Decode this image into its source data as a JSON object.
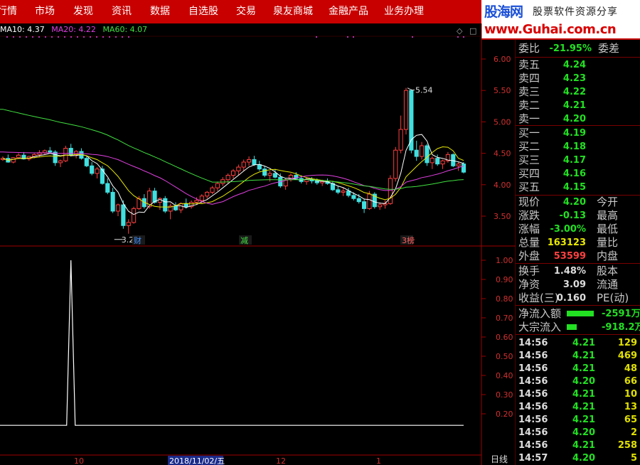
{
  "menu": [
    "行情",
    "市场",
    "发现",
    "资讯",
    "数据",
    "自选股",
    "交易",
    "泉友商城",
    "金融产品",
    "业务办理"
  ],
  "logo": {
    "name": "股海网",
    "slogan": "股票软件资源分享",
    "url": "www.Guhai.com.cn"
  },
  "ma_legend": [
    {
      "label": "MA10: 4.37",
      "color": "#ffffff"
    },
    {
      "label": "MA20: 4.22",
      "color": "#e040e0"
    },
    {
      "label": "MA60: 4.07",
      "color": "#40e040"
    }
  ],
  "price_axis": [
    "6.00",
    "5.50",
    "5.00",
    "4.50",
    "4.00",
    "3.50"
  ],
  "indicator_axis": [
    "1.00",
    "0.90",
    "0.80",
    "0.70",
    "0.60",
    "0.50",
    "0.40",
    "0.30",
    "0.20"
  ],
  "annotations": {
    "high": "5.54",
    "low": "3.22"
  },
  "event_markers": [
    "财",
    "减",
    "3榜"
  ],
  "date_axis": {
    "month1": "10",
    "current_date": "2018/11/02/五",
    "month2": "12",
    "month3": "1",
    "period": "日线"
  },
  "order_book": {
    "wei_bi": {
      "label": "委比",
      "value": "-21.95%",
      "label2": "委差"
    },
    "asks": [
      {
        "label": "卖五",
        "price": "4.24"
      },
      {
        "label": "卖四",
        "price": "4.23"
      },
      {
        "label": "卖三",
        "price": "4.22"
      },
      {
        "label": "卖二",
        "price": "4.21"
      },
      {
        "label": "卖一",
        "price": "4.20"
      }
    ],
    "bids": [
      {
        "label": "买一",
        "price": "4.19"
      },
      {
        "label": "买二",
        "price": "4.18"
      },
      {
        "label": "买三",
        "price": "4.17"
      },
      {
        "label": "买四",
        "price": "4.16"
      },
      {
        "label": "买五",
        "price": "4.15"
      }
    ]
  },
  "quote": {
    "price": {
      "label": "现价",
      "value": "4.20",
      "label2": "今开"
    },
    "change": {
      "label": "涨跌",
      "value": "-0.13",
      "label2": "最高"
    },
    "change_pct": {
      "label": "涨幅",
      "value": "-3.00%",
      "label2": "最低"
    },
    "volume": {
      "label": "总量",
      "value": "163123",
      "label2": "量比"
    },
    "outer": {
      "label": "外盘",
      "value": "53599",
      "label2": "内盘"
    },
    "turnover": {
      "label": "换手",
      "value": "1.48%",
      "label2": "股本"
    },
    "net_asset": {
      "label": "净资",
      "value": "3.09",
      "label2": "流通"
    },
    "eps": {
      "label": "收益(三)",
      "value": "0.160",
      "label2": "PE(动)"
    }
  },
  "flows": [
    {
      "label": "净流入额",
      "value": "-2591万",
      "bar": 0.85
    },
    {
      "label": "大宗流入",
      "value": "-918.2万",
      "bar": 0.3
    }
  ],
  "ticks": [
    {
      "time": "14:56",
      "price": "4.21",
      "vol": "129"
    },
    {
      "time": "14:56",
      "price": "4.21",
      "vol": "469"
    },
    {
      "time": "14:56",
      "price": "4.21",
      "vol": "48"
    },
    {
      "time": "14:56",
      "price": "4.20",
      "vol": "66"
    },
    {
      "time": "14:56",
      "price": "4.21",
      "vol": "10"
    },
    {
      "time": "14:56",
      "price": "4.21",
      "vol": "13"
    },
    {
      "time": "14:56",
      "price": "4.21",
      "vol": "65"
    },
    {
      "time": "14:56",
      "price": "4.20",
      "vol": "2"
    },
    {
      "time": "14:56",
      "price": "4.21",
      "vol": "258"
    },
    {
      "time": "14:57",
      "price": "4.20",
      "vol": "5"
    }
  ],
  "colors": {
    "menu_bg": "#c80000",
    "up": "#ff4040",
    "down": "#40e0e0",
    "green": "#22e022",
    "ma10": "#ffffff",
    "ma20": "#e040e0",
    "ma60": "#40e040"
  },
  "chart_data": {
    "type": "candlestick",
    "price_range": [
      3.2,
      6.1
    ],
    "ohlc": [
      [
        4.4,
        4.45,
        4.38,
        4.42
      ],
      [
        4.42,
        4.48,
        4.35,
        4.36
      ],
      [
        4.36,
        4.44,
        4.34,
        4.43
      ],
      [
        4.43,
        4.5,
        4.41,
        4.47
      ],
      [
        4.47,
        4.52,
        4.4,
        4.41
      ],
      [
        4.41,
        4.46,
        4.38,
        4.45
      ],
      [
        4.45,
        4.5,
        4.42,
        4.48
      ],
      [
        4.48,
        4.55,
        4.44,
        4.51
      ],
      [
        4.51,
        4.56,
        4.48,
        4.54
      ],
      [
        4.54,
        4.6,
        4.5,
        4.52
      ],
      [
        4.52,
        4.55,
        4.3,
        4.35
      ],
      [
        4.35,
        4.4,
        4.28,
        4.38
      ],
      [
        4.38,
        4.62,
        4.36,
        4.58
      ],
      [
        4.58,
        4.65,
        4.45,
        4.48
      ],
      [
        4.48,
        4.55,
        4.42,
        4.53
      ],
      [
        4.53,
        4.58,
        4.4,
        4.42
      ],
      [
        4.42,
        4.46,
        4.28,
        4.3
      ],
      [
        4.3,
        4.36,
        4.15,
        4.18
      ],
      [
        4.18,
        4.28,
        4.1,
        4.25
      ],
      [
        4.25,
        4.3,
        4.0,
        4.02
      ],
      [
        4.02,
        4.1,
        3.85,
        3.88
      ],
      [
        3.88,
        3.95,
        3.55,
        3.58
      ],
      [
        3.58,
        3.7,
        3.5,
        3.68
      ],
      [
        3.68,
        3.75,
        3.3,
        3.35
      ],
      [
        3.35,
        3.45,
        3.22,
        3.4
      ],
      [
        3.4,
        3.65,
        3.38,
        3.62
      ],
      [
        3.62,
        3.82,
        3.6,
        3.78
      ],
      [
        3.78,
        3.85,
        3.62,
        3.65
      ],
      [
        3.65,
        3.95,
        3.62,
        3.9
      ],
      [
        3.9,
        3.95,
        3.7,
        3.72
      ],
      [
        3.72,
        3.8,
        3.6,
        3.78
      ],
      [
        3.78,
        3.82,
        3.55,
        3.58
      ],
      [
        3.58,
        3.7,
        3.45,
        3.66
      ],
      [
        3.66,
        3.72,
        3.58,
        3.6
      ],
      [
        3.6,
        3.72,
        3.55,
        3.7
      ],
      [
        3.7,
        3.78,
        3.62,
        3.65
      ],
      [
        3.65,
        3.75,
        3.62,
        3.72
      ],
      [
        3.72,
        3.8,
        3.68,
        3.75
      ],
      [
        3.75,
        3.85,
        3.7,
        3.82
      ],
      [
        3.82,
        3.9,
        3.78,
        3.88
      ],
      [
        3.88,
        3.98,
        3.85,
        3.95
      ],
      [
        3.95,
        4.05,
        3.9,
        4.02
      ],
      [
        4.02,
        4.12,
        3.98,
        4.08
      ],
      [
        4.08,
        4.18,
        4.02,
        4.15
      ],
      [
        4.15,
        4.25,
        4.1,
        4.22
      ],
      [
        4.22,
        4.32,
        4.15,
        4.28
      ],
      [
        4.28,
        4.4,
        4.22,
        4.36
      ],
      [
        4.36,
        4.45,
        4.3,
        4.4
      ],
      [
        4.4,
        4.46,
        4.3,
        4.32
      ],
      [
        4.32,
        4.38,
        4.22,
        4.25
      ],
      [
        4.25,
        4.3,
        4.12,
        4.15
      ],
      [
        4.15,
        4.22,
        4.05,
        4.18
      ],
      [
        4.18,
        4.25,
        4.1,
        4.12
      ],
      [
        4.12,
        4.18,
        3.95,
        3.98
      ],
      [
        3.98,
        4.1,
        3.92,
        4.08
      ],
      [
        4.08,
        4.18,
        4.05,
        4.15
      ],
      [
        4.15,
        4.2,
        4.08,
        4.1
      ],
      [
        4.1,
        4.15,
        4.02,
        4.05
      ],
      [
        4.05,
        4.12,
        4.0,
        4.08
      ],
      [
        4.08,
        4.12,
        4.02,
        4.06
      ],
      [
        4.06,
        4.1,
        4.0,
        4.03
      ],
      [
        4.03,
        4.08,
        3.98,
        4.05
      ],
      [
        4.05,
        4.1,
        4.0,
        4.02
      ],
      [
        4.02,
        4.06,
        3.9,
        3.92
      ],
      [
        3.92,
        3.98,
        3.85,
        3.88
      ],
      [
        3.88,
        3.95,
        3.82,
        3.9
      ],
      [
        3.9,
        3.95,
        3.8,
        3.83
      ],
      [
        3.83,
        3.88,
        3.75,
        3.78
      ],
      [
        3.78,
        3.85,
        3.7,
        3.73
      ],
      [
        3.73,
        3.78,
        3.55,
        3.62
      ],
      [
        3.62,
        3.9,
        3.6,
        3.85
      ],
      [
        3.85,
        3.88,
        3.62,
        3.65
      ],
      [
        3.65,
        3.72,
        3.6,
        3.68
      ],
      [
        3.68,
        3.75,
        3.62,
        3.7
      ],
      [
        3.7,
        4.15,
        3.68,
        4.1
      ],
      [
        4.1,
        4.6,
        4.05,
        4.55
      ],
      [
        4.55,
        5.1,
        4.5,
        4.88
      ],
      [
        4.88,
        5.54,
        4.8,
        5.5
      ],
      [
        5.5,
        5.52,
        4.5,
        4.55
      ],
      [
        4.55,
        4.7,
        4.38,
        4.45
      ],
      [
        4.45,
        4.68,
        4.4,
        4.62
      ],
      [
        4.62,
        4.65,
        4.3,
        4.35
      ],
      [
        4.35,
        4.45,
        4.25,
        4.42
      ],
      [
        4.42,
        4.48,
        4.3,
        4.33
      ],
      [
        4.33,
        4.4,
        4.25,
        4.38
      ],
      [
        4.38,
        4.52,
        4.35,
        4.48
      ],
      [
        4.48,
        4.5,
        4.28,
        4.3
      ],
      [
        4.3,
        4.36,
        4.22,
        4.33
      ],
      [
        4.33,
        4.36,
        4.18,
        4.2
      ]
    ],
    "ma_last": {
      "MA10": 4.37,
      "MA20": 4.22,
      "MA60": 4.07
    },
    "indicator_range": [
      0.1,
      1.05
    ],
    "indicator_peak": {
      "index": 13,
      "value": 1.0
    }
  }
}
